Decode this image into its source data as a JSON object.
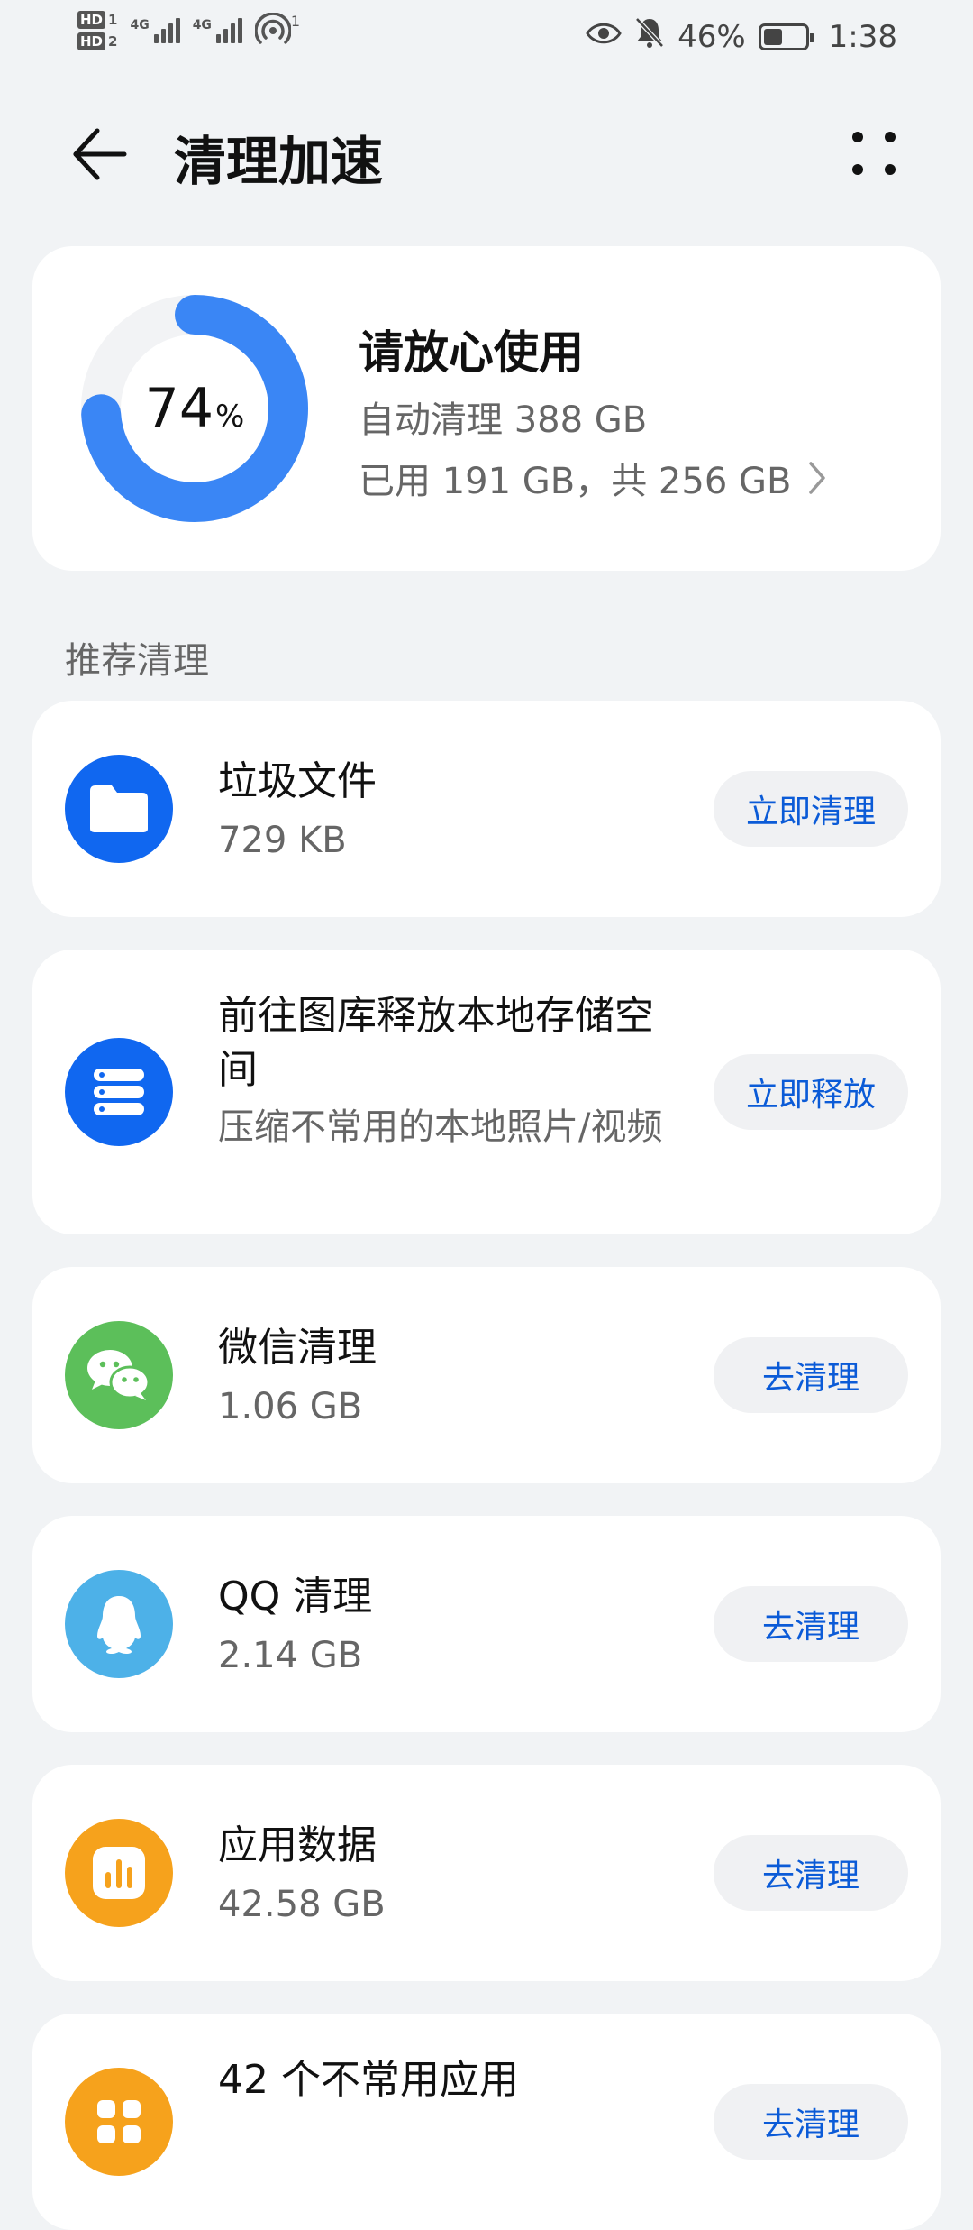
{
  "status_bar": {
    "sim1": "HD",
    "sim1_num": "1",
    "sim2": "HD",
    "sim2_num": "2",
    "network1": "4G",
    "network2": "4G",
    "hotspot_count": "1",
    "battery_percent": "46%",
    "battery_level": 0.46,
    "time": "1:38",
    "icons": [
      "eye-icon",
      "bell-off-icon",
      "hotspot-icon",
      "battery-icon"
    ]
  },
  "header": {
    "title": "清理加速",
    "back_icon": "arrow-left-icon",
    "more_icon": "more-dots-icon"
  },
  "storage": {
    "percent": "74",
    "percent_sign": "%",
    "percent_value": 0.74,
    "title": "请放心使用",
    "auto_clean": "自动清理 388 GB",
    "used": "已用 191 GB，共 256 GB",
    "ring_color": "#3a86f5",
    "track_color": "#f2f3f5"
  },
  "section": {
    "label": "推荐清理"
  },
  "items": [
    {
      "title": "垃圾文件",
      "subtitle": "729 KB",
      "action": "立即清理",
      "icon": "folder-icon",
      "color": "#1067f0"
    },
    {
      "title": "前往图库释放本地存储空间",
      "subtitle": "压缩不常用的本地照片/视频",
      "action": "立即释放",
      "icon": "storage-stack-icon",
      "color": "#1067f0"
    },
    {
      "title": "微信清理",
      "subtitle": "1.06 GB",
      "action": "去清理",
      "icon": "wechat-icon",
      "color": "#5cbf5a"
    },
    {
      "title": "QQ 清理",
      "subtitle": "2.14 GB",
      "action": "去清理",
      "icon": "qq-penguin-icon",
      "color": "#4db1e8"
    },
    {
      "title": "应用数据",
      "subtitle": "42.58 GB",
      "action": "去清理",
      "icon": "app-data-icon",
      "color": "#f6a21c"
    },
    {
      "title": "42 个不常用应用",
      "subtitle": "",
      "action": "去清理",
      "icon": "apps-grid-icon",
      "color": "#f6a21c"
    }
  ]
}
